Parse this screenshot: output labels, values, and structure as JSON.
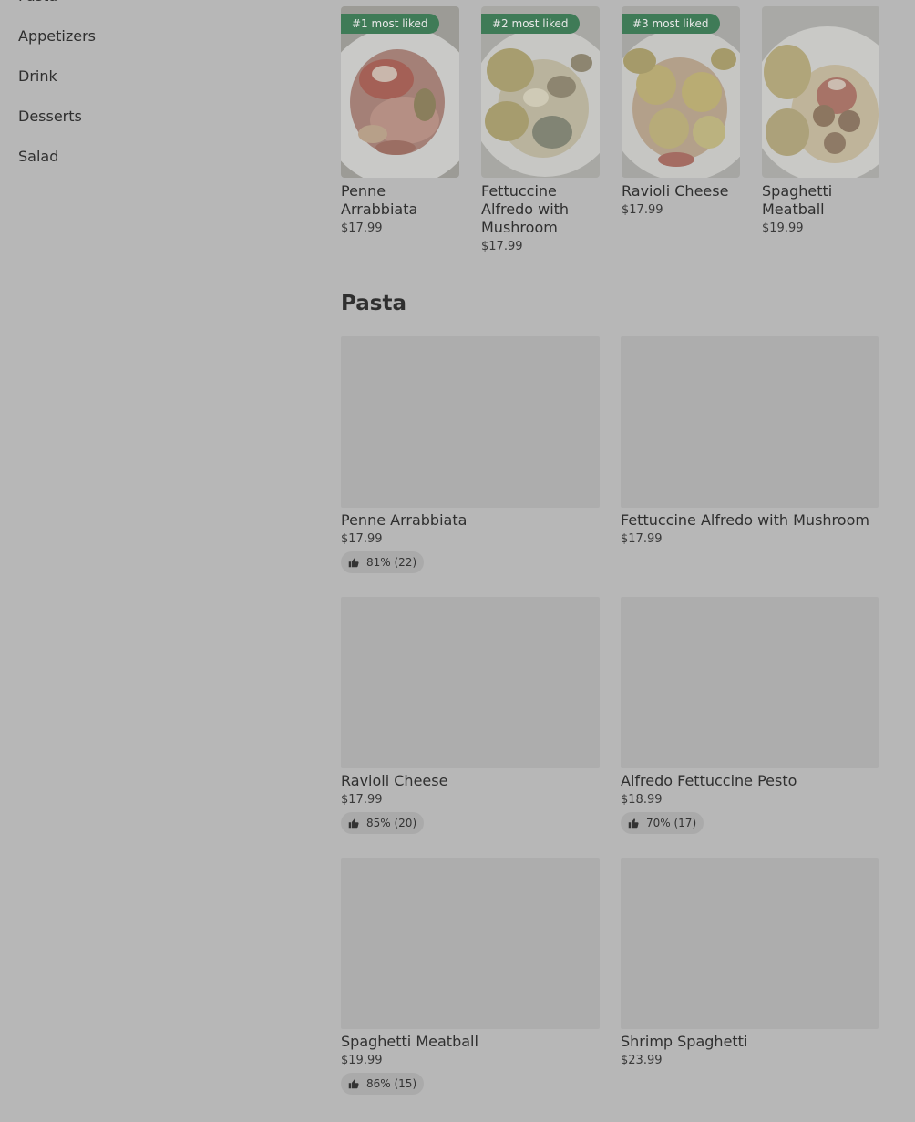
{
  "nav": {
    "items": [
      {
        "label": "Pasta"
      },
      {
        "label": "Appetizers"
      },
      {
        "label": "Drink"
      },
      {
        "label": "Desserts"
      },
      {
        "label": "Salad"
      }
    ]
  },
  "carousel": {
    "items": [
      {
        "badge": "#1 most liked",
        "name": "Penne Arrabbiata",
        "price": "$17.99"
      },
      {
        "badge": "#2 most liked",
        "name": "Fettuccine Alfredo with Mushroom",
        "price": "$17.99"
      },
      {
        "badge": "#3 most liked",
        "name": "Ravioli Cheese",
        "price": "$17.99"
      },
      {
        "badge": "",
        "name": "Spaghetti Meatball",
        "price": "$19.99"
      }
    ]
  },
  "section": {
    "title": "Pasta",
    "items": [
      {
        "name": "Penne Arrabbiata",
        "price": "$17.99",
        "rating": "81% (22)"
      },
      {
        "name": "Fettuccine Alfredo with Mushroom",
        "price": "$17.99",
        "rating": ""
      },
      {
        "name": "Ravioli Cheese",
        "price": "$17.99",
        "rating": "85% (20)"
      },
      {
        "name": "Alfredo Fettuccine Pesto",
        "price": "$18.99",
        "rating": "70% (17)"
      },
      {
        "name": "Spaghetti Meatball",
        "price": "$19.99",
        "rating": "86% (15)"
      },
      {
        "name": "Shrimp Spaghetti",
        "price": "$23.99",
        "rating": ""
      }
    ]
  },
  "colors": {
    "overlay": "#b7b7b7",
    "badge": "#3f7b57"
  },
  "icons": {
    "rating": "thumbs-up-icon"
  }
}
